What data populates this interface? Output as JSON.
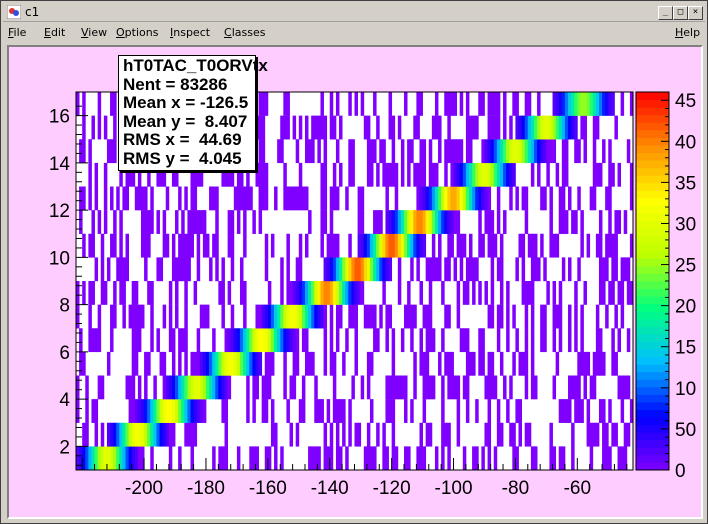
{
  "window": {
    "title": "c1",
    "buttons": [
      "_",
      "□",
      "×"
    ]
  },
  "menu": {
    "items": [
      {
        "label": "File",
        "accel": "F"
      },
      {
        "label": "Edit",
        "accel": "E"
      },
      {
        "label": "View",
        "accel": "V"
      },
      {
        "label": "Options",
        "accel": "O"
      },
      {
        "label": "Inspect",
        "accel": "I"
      },
      {
        "label": "Classes",
        "accel": "C"
      }
    ],
    "help": {
      "label": "Help",
      "accel": "H"
    }
  },
  "stats": {
    "name": "hT0TAC_T0ORVtx",
    "entries": "Nent = 83286",
    "mean_x": "Mean x = -126.5",
    "mean_y": "Mean y =  8.407",
    "rms_x": "RMS x =  44.69",
    "rms_y": "RMS y =  4.045"
  },
  "colors": {
    "canvas_bg": "#ffccff",
    "frame_bg": "#ffffff",
    "low_bin": "#7f00ff",
    "palette": [
      "#7f00ff",
      "#0000ff",
      "#00bfff",
      "#00ff7f",
      "#bfff00",
      "#ffff00",
      "#ff8c00",
      "#ff0000"
    ]
  },
  "chart_data": {
    "type": "heatmap",
    "title": "",
    "xlabel": "",
    "ylabel": "",
    "xlim": [
      -222,
      -42
    ],
    "ylim": [
      1,
      17
    ],
    "zlim": [
      0,
      46
    ],
    "x_ticks": [
      -200,
      -180,
      -160,
      -140,
      -120,
      -100,
      -80,
      -60
    ],
    "y_ticks": [
      2,
      4,
      6,
      8,
      10,
      12,
      14,
      16
    ],
    "z_ticks": [
      0,
      5,
      10,
      15,
      20,
      25,
      30,
      35,
      40,
      45
    ],
    "z_tick_labels": [
      "0",
      "50",
      "10",
      "15",
      "20",
      "25",
      "30",
      "35",
      "40",
      "45"
    ],
    "ridge": {
      "description_free": true,
      "points": [
        {
          "y": 1.5,
          "x_peak": -212,
          "z_peak": 30
        },
        {
          "y": 2.5,
          "x_peak": -202,
          "z_peak": 32
        },
        {
          "y": 3.5,
          "x_peak": -192,
          "z_peak": 33
        },
        {
          "y": 4.5,
          "x_peak": -183,
          "z_peak": 30
        },
        {
          "y": 5.5,
          "x_peak": -172,
          "z_peak": 32
        },
        {
          "y": 6.5,
          "x_peak": -162,
          "z_peak": 33
        },
        {
          "y": 7.5,
          "x_peak": -152,
          "z_peak": 32
        },
        {
          "y": 8.5,
          "x_peak": -141,
          "z_peak": 40
        },
        {
          "y": 9.5,
          "x_peak": -131,
          "z_peak": 42
        },
        {
          "y": 10.5,
          "x_peak": -120,
          "z_peak": 42
        },
        {
          "y": 11.5,
          "x_peak": -111,
          "z_peak": 40
        },
        {
          "y": 12.5,
          "x_peak": -100,
          "z_peak": 38
        },
        {
          "y": 13.5,
          "x_peak": -90,
          "z_peak": 30
        },
        {
          "y": 14.5,
          "x_peak": -80,
          "z_peak": 30
        },
        {
          "y": 15.5,
          "x_peak": -70,
          "z_peak": 30
        },
        {
          "y": 16.5,
          "x_peak": -58,
          "z_peak": 25
        }
      ],
      "width_x": 6
    }
  }
}
